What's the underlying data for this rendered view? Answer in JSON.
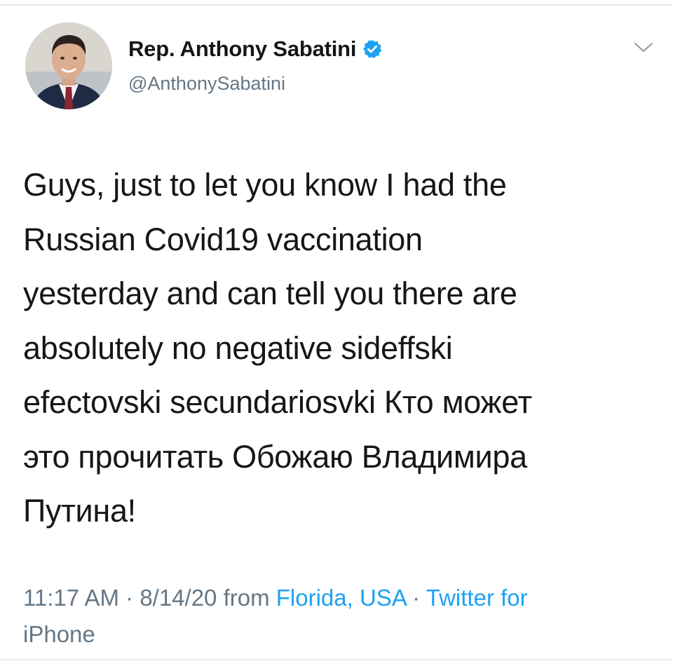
{
  "author": {
    "display_name": "Rep. Anthony Sabatini",
    "handle": "@AnthonySabatini",
    "verified": true,
    "avatar_icon": "profile-photo"
  },
  "tweet": {
    "text_lines": [
      "Guys, just to let you know I had the",
      "Russian Covid19 vaccination",
      "yesterday and can tell you there are",
      "absolutely no negative sideffski",
      "efectovski secundariosvki Кто может",
      "это прочитать Обожаю Владимира",
      "Путина!"
    ]
  },
  "meta": {
    "time": "11:17 AM",
    "sep1": " · ",
    "date": "8/14/20",
    "from_word": " from ",
    "location": "Florida, USA",
    "sep2": " · ",
    "client_line1": "Twitter for",
    "client_line2": "iPhone"
  },
  "colors": {
    "text": "#14171a",
    "muted": "#657786",
    "link": "#1da1f2",
    "verified": "#1da1f2"
  },
  "icons": {
    "verified": "verified-badge-icon",
    "menu": "chevron-down-icon"
  }
}
